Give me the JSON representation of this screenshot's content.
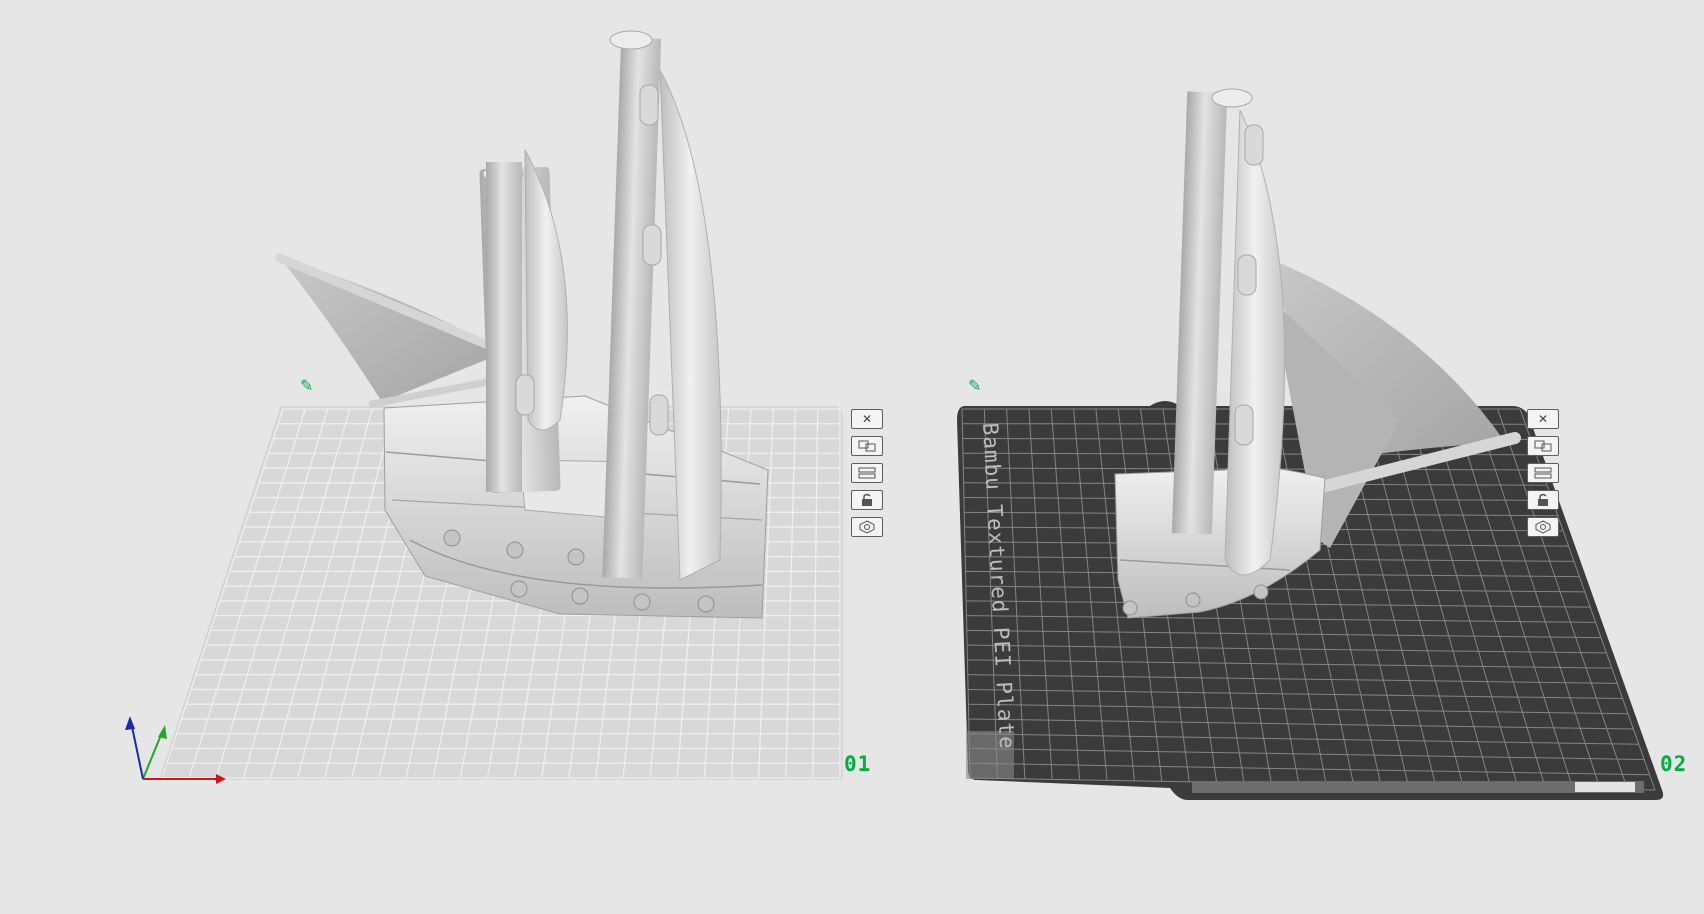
{
  "app": {
    "view": "3D Prepare View"
  },
  "colors": {
    "background": "#e6e6e6",
    "accent": "#00ae42",
    "plate_light": "#d9d9d9",
    "plate_dark": "#3b3b3b",
    "model": "#dcdcdc",
    "axis_x": "#d0161d",
    "axis_y": "#23a62a",
    "axis_z": "#1a2aa8"
  },
  "plates": [
    {
      "index_label": "01",
      "edit_icon": "pencil-icon",
      "texture": "none",
      "model": "ship-3-masts",
      "toolbar": [
        {
          "name": "remove-plate",
          "icon": "close-icon"
        },
        {
          "name": "arrange",
          "icon": "arrange-icon"
        },
        {
          "name": "orient",
          "icon": "orient-icon"
        },
        {
          "name": "lock",
          "icon": "unlock-icon"
        },
        {
          "name": "settings",
          "icon": "gear-icon"
        }
      ]
    },
    {
      "index_label": "02",
      "edit_icon": "pencil-icon",
      "texture": "textured-pei",
      "plate_type_label": "Bambu Textured PEI Plate",
      "model": "ship-1-mast",
      "toolbar": [
        {
          "name": "remove-plate",
          "icon": "close-icon"
        },
        {
          "name": "arrange",
          "icon": "arrange-icon"
        },
        {
          "name": "orient",
          "icon": "orient-icon"
        },
        {
          "name": "lock",
          "icon": "unlock-icon"
        },
        {
          "name": "settings",
          "icon": "gear-icon"
        }
      ]
    }
  ],
  "axes": {
    "x": "x-axis",
    "y": "y-axis",
    "z": "z-axis"
  }
}
